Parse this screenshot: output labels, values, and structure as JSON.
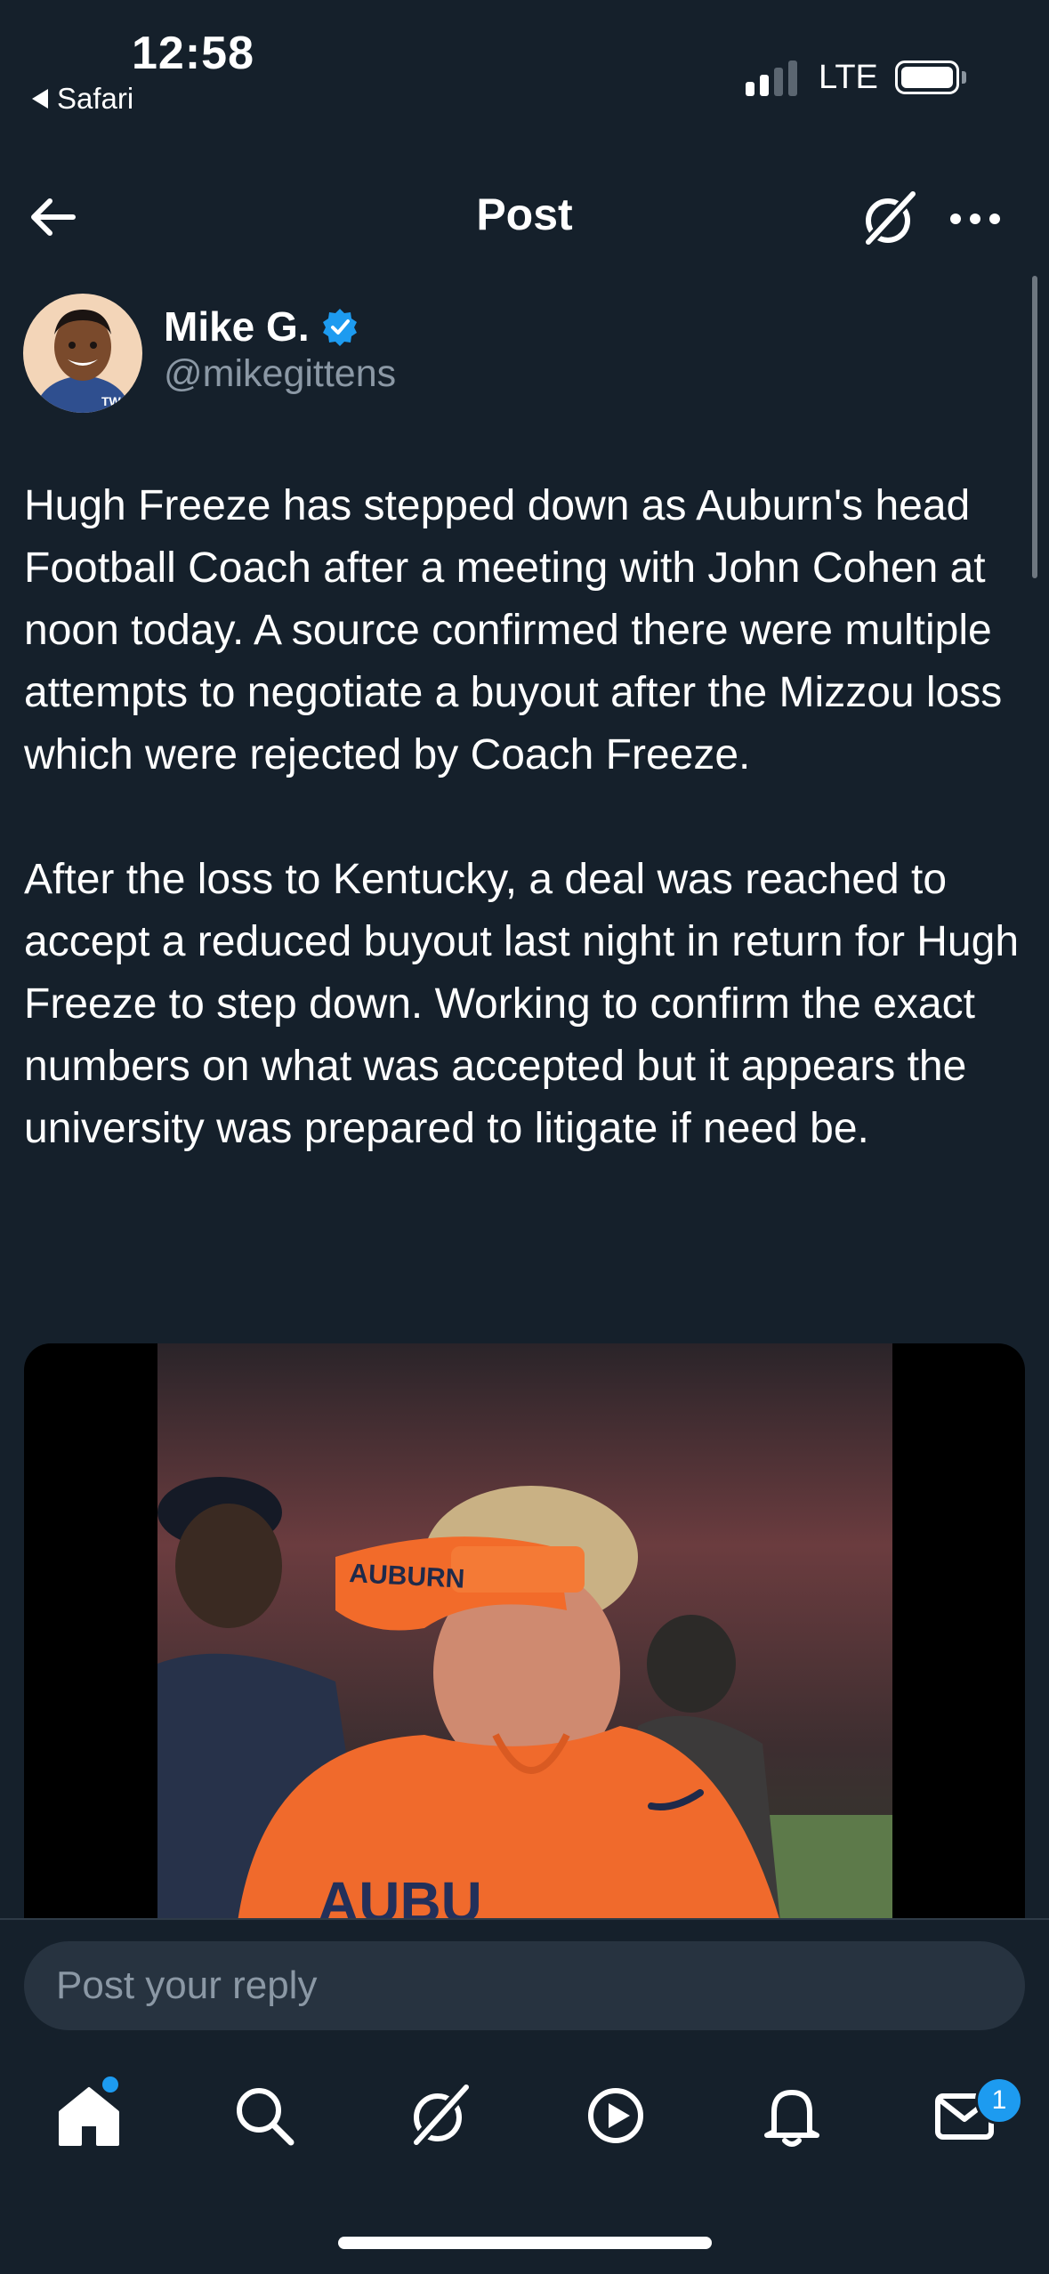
{
  "status_bar": {
    "time": "12:58",
    "back_app": "Safari",
    "network": "LTE",
    "signal_bars_active": 2,
    "signal_bars_total": 4
  },
  "header": {
    "title": "Post",
    "icons": [
      "back-arrow-icon",
      "grok-icon",
      "more-icon"
    ]
  },
  "author": {
    "name": "Mike G.",
    "handle": "@mikegittens",
    "verified": true,
    "avatar_text": "TW"
  },
  "tweet": {
    "text": "Hugh Freeze has stepped down as Auburn's head Football Coach after a meeting with John Cohen at noon today. A source confirmed there were multiple attempts to negotiate a buyout after the Mizzou loss which were rejected by Coach Freeze.\n\nAfter the loss to Kentucky, a deal was reached to accept a reduced buyout last night in return for Hugh Freeze to step down. Working to confirm the exact numbers on what was accepted but it appears the university was prepared to litigate if need be."
  },
  "media": {
    "visor_text": "AUBURN",
    "shirt_text": "AUBU"
  },
  "reply": {
    "placeholder": "Post your reply"
  },
  "bottom_nav": {
    "items": [
      "home-icon",
      "search-icon",
      "grok-icon",
      "video-icon",
      "notifications-icon",
      "messages-icon"
    ],
    "messages_badge": "1"
  },
  "colors": {
    "background": "#15202b",
    "accent": "#1d9bf0",
    "secondary_text": "#8b98a5",
    "input_bg": "#273340"
  }
}
